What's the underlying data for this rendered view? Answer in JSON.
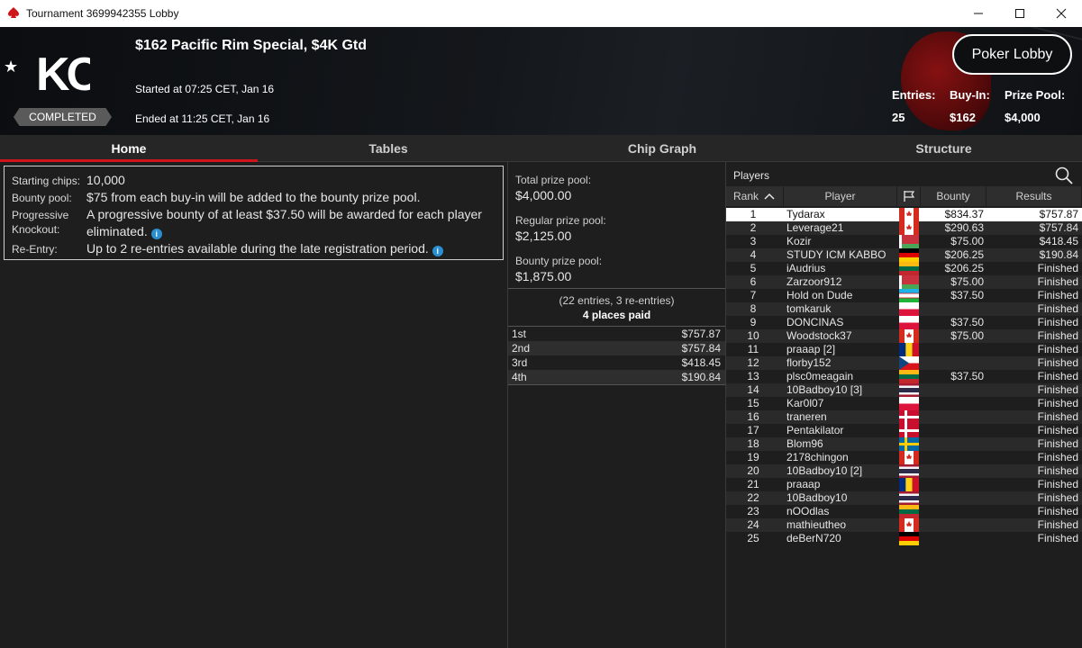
{
  "window": {
    "title": "Tournament 3699942355 Lobby"
  },
  "header": {
    "logo_text": "KO",
    "tournament_name": "$162 Pacific Rim Special, $4K Gtd",
    "started": "Started at 07:25 CET, Jan 16",
    "ended": "Ended at 11:25 CET, Jan 16",
    "status": "COMPLETED",
    "poker_lobby_label": "Poker Lobby",
    "entries_label": "Entries:",
    "entries_value": "25",
    "buyin_label": "Buy-In:",
    "buyin_value": "$162",
    "prizepool_label": "Prize Pool:",
    "prizepool_value": "$4,000"
  },
  "tabs": [
    {
      "label": "Home"
    },
    {
      "label": "Tables"
    },
    {
      "label": "Chip Graph"
    },
    {
      "label": "Structure"
    }
  ],
  "info": {
    "starting_chips_label": "Starting chips:",
    "starting_chips_value": "10,000",
    "bounty_pool_label": "Bounty pool:",
    "bounty_pool_value": "$75 from each buy-in will be added to the bounty prize pool.",
    "progressive_label_1": "Progressive",
    "progressive_label_2": "Knockout:",
    "progressive_value_1": "A progressive bounty of at least $37.50 will be awarded for each player",
    "progressive_value_2": "eliminated.",
    "reentry_label": "Re-Entry:",
    "reentry_value": "Up to 2 re-entries available during the late registration period.",
    "info_glyph": "i"
  },
  "prizes": {
    "total_label": "Total prize pool:",
    "total_value": "$4,000.00",
    "regular_label": "Regular prize pool:",
    "regular_value": "$2,125.00",
    "bounty_label": "Bounty prize pool:",
    "bounty_value": "$1,875.00",
    "entries_text": "(22 entries, 3 re-entries)",
    "places_text": "4 places paid",
    "payouts": [
      {
        "place": "1st",
        "amount": "$757.87"
      },
      {
        "place": "2nd",
        "amount": "$757.84"
      },
      {
        "place": "3rd",
        "amount": "$418.45"
      },
      {
        "place": "4th",
        "amount": "$190.84"
      }
    ]
  },
  "players": {
    "title": "Players",
    "col_rank": "Rank",
    "col_player": "Player",
    "col_bounty": "Bounty",
    "col_results": "Results",
    "rows": [
      {
        "rank": "1",
        "name": "Tydarax",
        "flag": "canada",
        "bounty": "$834.37",
        "result": "$757.87"
      },
      {
        "rank": "2",
        "name": "Leverage21",
        "flag": "canada",
        "bounty": "$290.63",
        "result": "$757.84"
      },
      {
        "rank": "3",
        "name": "Kozir",
        "flag": "belarus",
        "bounty": "$75.00",
        "result": "$418.45"
      },
      {
        "rank": "4",
        "name": "STUDY ICM KABBO",
        "flag": "germany",
        "bounty": "$206.25",
        "result": "$190.84"
      },
      {
        "rank": "5",
        "name": "iAudrius",
        "flag": "lithuania",
        "bounty": "$206.25",
        "result": "Finished"
      },
      {
        "rank": "6",
        "name": "Zarzoor912",
        "flag": "belarus",
        "bounty": "$75.00",
        "result": "Finished"
      },
      {
        "rank": "7",
        "name": "Hold on Dude",
        "flag": "uzbekistan",
        "bounty": "$37.50",
        "result": "Finished"
      },
      {
        "rank": "8",
        "name": "tomkaruk",
        "flag": "poland",
        "bounty": "",
        "result": "Finished"
      },
      {
        "rank": "9",
        "name": "DONCINAS",
        "flag": "poland",
        "bounty": "$37.50",
        "result": "Finished"
      },
      {
        "rank": "10",
        "name": "Woodstock37",
        "flag": "canada",
        "bounty": "$75.00",
        "result": "Finished"
      },
      {
        "rank": "11",
        "name": "praaap [2]",
        "flag": "romania",
        "bounty": "",
        "result": "Finished"
      },
      {
        "rank": "12",
        "name": "florby152",
        "flag": "czechia",
        "bounty": "",
        "result": "Finished"
      },
      {
        "rank": "13",
        "name": "plsc0meagain",
        "flag": "lithuania",
        "bounty": "$37.50",
        "result": "Finished"
      },
      {
        "rank": "14",
        "name": "10Badboy10 [3]",
        "flag": "thailand",
        "bounty": "",
        "result": "Finished"
      },
      {
        "rank": "15",
        "name": "Kar0l07",
        "flag": "poland",
        "bounty": "",
        "result": "Finished"
      },
      {
        "rank": "16",
        "name": "traneren",
        "flag": "denmark",
        "bounty": "",
        "result": "Finished"
      },
      {
        "rank": "17",
        "name": "Pentakilator",
        "flag": "denmark",
        "bounty": "",
        "result": "Finished"
      },
      {
        "rank": "18",
        "name": "Blom96",
        "flag": "sweden",
        "bounty": "",
        "result": "Finished"
      },
      {
        "rank": "19",
        "name": "2178chingon",
        "flag": "canada",
        "bounty": "",
        "result": "Finished"
      },
      {
        "rank": "20",
        "name": "10Badboy10 [2]",
        "flag": "thailand",
        "bounty": "",
        "result": "Finished"
      },
      {
        "rank": "21",
        "name": "praaap",
        "flag": "romania",
        "bounty": "",
        "result": "Finished"
      },
      {
        "rank": "22",
        "name": "10Badboy10",
        "flag": "thailand",
        "bounty": "",
        "result": "Finished"
      },
      {
        "rank": "23",
        "name": "nOOdlas",
        "flag": "lithuania",
        "bounty": "",
        "result": "Finished"
      },
      {
        "rank": "24",
        "name": "mathieutheo",
        "flag": "canada",
        "bounty": "",
        "result": "Finished"
      },
      {
        "rank": "25",
        "name": "deBerN720",
        "flag": "germany",
        "bounty": "",
        "result": "Finished"
      }
    ]
  },
  "colors": {
    "accent_red": "#d0141c",
    "info_blue": "#2a8fd1",
    "selected_row": "#ffffff"
  }
}
